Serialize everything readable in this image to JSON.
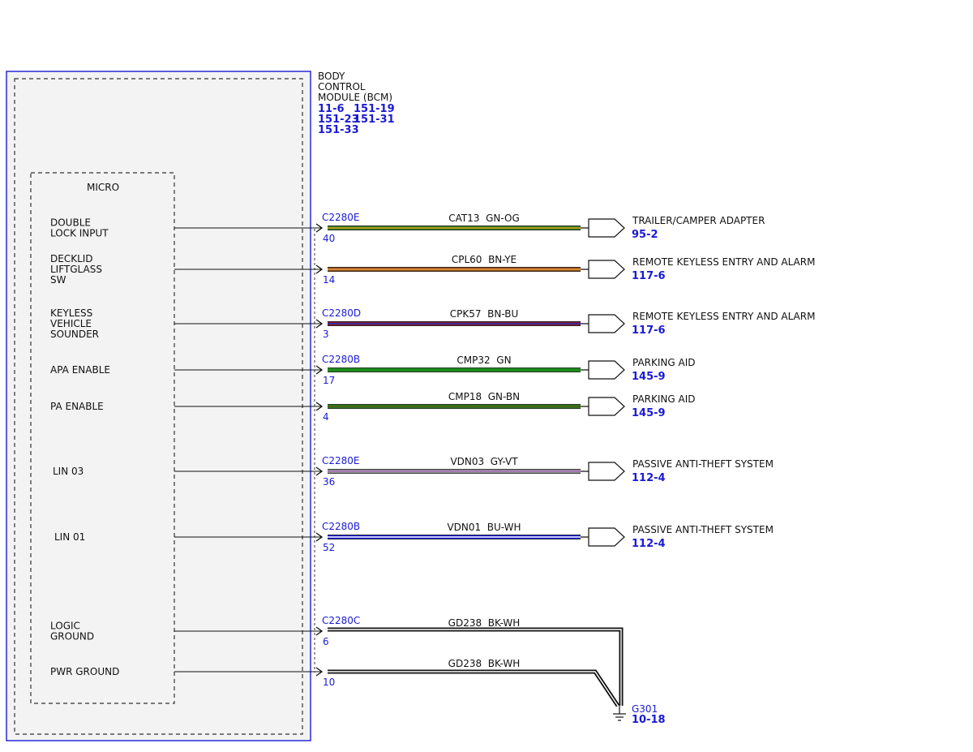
{
  "module": {
    "title_lines": [
      "BODY",
      "CONTROL",
      "MODULE (BCM)"
    ],
    "refs": [
      [
        "11-6",
        "151-19"
      ],
      [
        "151-23",
        "151-31"
      ],
      [
        "151-33"
      ]
    ],
    "micro_label": "MICRO"
  },
  "colors": {
    "border_blue": "#2a2ad8",
    "link_blue": "#1a1ad6",
    "module_fill": "#f3f3f3"
  },
  "pins": [
    {
      "label_lines": [
        "DOUBLE",
        "LOCK INPUT"
      ],
      "connector": "C2280E",
      "pin": "40",
      "circuit": "CAT13  GN-OG",
      "wire_colors": [
        "#2f7d1e",
        "#e0a020"
      ],
      "dest": "TRAILER/CAMPER ADAPTER",
      "dest_ref": "95-2"
    },
    {
      "label_lines": [
        "DECKLID",
        "LIFTGLASS",
        "SW"
      ],
      "connector": "",
      "pin": "14",
      "circuit": "CPL60  BN-YE",
      "wire_colors": [
        "#8b4a1a",
        "#f0a040"
      ],
      "dest": "REMOTE KEYLESS ENTRY AND ALARM",
      "dest_ref": "117-6"
    },
    {
      "label_lines": [
        "KEYLESS",
        "VEHICLE",
        "SOUNDER"
      ],
      "connector": "C2280D",
      "pin": "3",
      "circuit": "CPK57  BN-BU",
      "wire_colors": [
        "#7a1a2a",
        "#3030c0"
      ],
      "dest": "REMOTE KEYLESS ENTRY AND ALARM",
      "dest_ref": "117-6"
    },
    {
      "label_lines": [
        "APA ENABLE"
      ],
      "connector": "C2280B",
      "pin": "17",
      "circuit": "CMP32  GN",
      "wire_colors": [
        "#1f8a1f",
        "#1f8a1f"
      ],
      "dest": "PARKING AID",
      "dest_ref": "145-9"
    },
    {
      "label_lines": [
        "PA ENABLE"
      ],
      "connector": "",
      "pin": "4",
      "circuit": "CMP18  GN-BN",
      "wire_colors": [
        "#2a7a1a",
        "#5a5a20"
      ],
      "dest": "PARKING AID",
      "dest_ref": "145-9"
    },
    {
      "label_lines": [
        "LIN 03"
      ],
      "connector": "C2280E",
      "pin": "36",
      "circuit": "VDN03  GY-VT",
      "wire_colors": [
        "#909090",
        "#b070c0"
      ],
      "dest": "PASSIVE ANTI-THEFT SYSTEM",
      "dest_ref": "112-4"
    },
    {
      "label_lines": [
        "LIN 01"
      ],
      "connector": "C2280B",
      "pin": "52",
      "circuit": "VDN01  BU-WH",
      "wire_colors": [
        "#1a1ad0",
        "#ffffff"
      ],
      "dest": "PASSIVE ANTI-THEFT SYSTEM",
      "dest_ref": "112-4"
    },
    {
      "label_lines": [
        "LOGIC",
        "GROUND"
      ],
      "connector": "C2280C",
      "pin": "6",
      "circuit": "GD238  BK-WH",
      "wire_colors": [
        "#111111",
        "#ffffff"
      ],
      "dest": "",
      "dest_ref": ""
    },
    {
      "label_lines": [
        "PWR GROUND"
      ],
      "connector": "",
      "pin": "10",
      "circuit": "GD238  BK-WH",
      "wire_colors": [
        "#111111",
        "#ffffff"
      ],
      "dest": "",
      "dest_ref": ""
    }
  ],
  "ground": {
    "name": "G301",
    "ref": "10-18"
  }
}
